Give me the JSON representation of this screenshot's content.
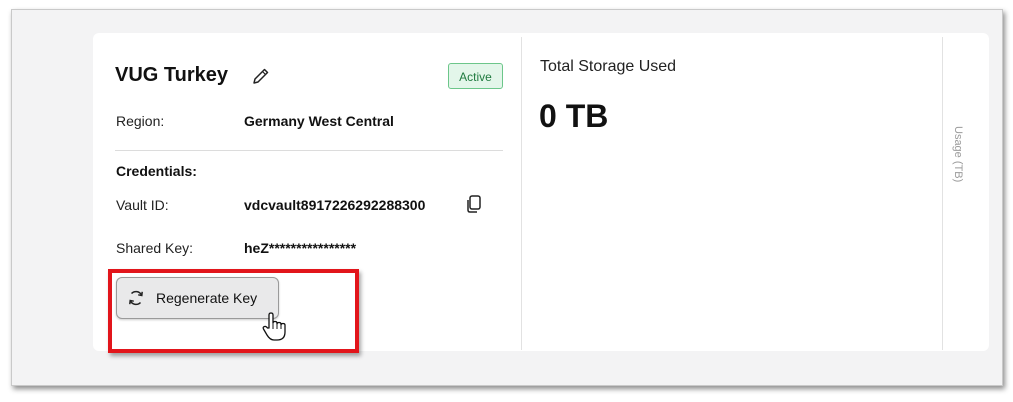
{
  "vault": {
    "name": "VUG Turkey",
    "status": "Active",
    "region_label": "Region:",
    "region_value": "Germany West Central",
    "credentials_label": "Credentials:",
    "vault_id_label": "Vault ID:",
    "vault_id_value": "vdcvault8917226292288300",
    "shared_key_label": "Shared Key:",
    "shared_key_value": "heZ****************",
    "regenerate_label": "Regenerate Key"
  },
  "storage": {
    "label": "Total Storage Used",
    "value": "0 TB"
  },
  "chart": {
    "axis_label": "Usage (TB)"
  },
  "colors": {
    "badge_border": "#6cc68a",
    "badge_bg": "#e3f6ea",
    "highlight": "#e2151b"
  },
  "icons": [
    "edit-pencil-icon",
    "copy-icon",
    "refresh-icon",
    "hand-pointer-cursor-icon"
  ]
}
